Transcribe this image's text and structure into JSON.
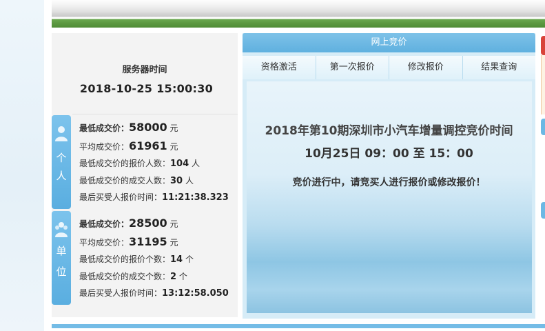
{
  "server": {
    "title": "服务器时间",
    "time": "2018-10-25 15:00:30"
  },
  "personal": {
    "tag1": "个",
    "tag2": "人",
    "rows": [
      {
        "label": "最低成交价：",
        "value": "58000",
        "unit": "元"
      },
      {
        "label": "平均成交价：",
        "value": "61961",
        "unit": "元"
      },
      {
        "label": "最低成交价的报价人数：",
        "value": "104",
        "unit": "人"
      },
      {
        "label": "最低成交价的成交人数：",
        "value": "30",
        "unit": "人"
      },
      {
        "label": "最后买受人报价时间：",
        "value": "11:21:38.323",
        "unit": ""
      }
    ]
  },
  "unit": {
    "tag1": "单",
    "tag2": "位",
    "rows": [
      {
        "label": "最低成交价：",
        "value": "28500",
        "unit": "元"
      },
      {
        "label": "平均成交价：",
        "value": "31195",
        "unit": "元"
      },
      {
        "label": "最低成交价的报价个数：",
        "value": "14",
        "unit": "个"
      },
      {
        "label": "最低成交价的成交个数：",
        "value": "2",
        "unit": "个"
      },
      {
        "label": "最后买受人报价时间：",
        "value": "13:12:58.050",
        "unit": ""
      }
    ]
  },
  "auction": {
    "header": "网上竞价",
    "tabs": [
      "资格激活",
      "第一次报价",
      "修改报价",
      "结果查询"
    ],
    "title": "2018年第10期深圳市小汽车增量调控竞价时间",
    "time": "10月25日 09：00 至 15：00",
    "status": "竞价进行中，请竞买人进行报价或修改报价！"
  },
  "colors": {
    "accent": "#5fb0df",
    "tag": "#6cb8e4"
  },
  "icons": {
    "person": "person-icon",
    "group": "group-icon"
  }
}
